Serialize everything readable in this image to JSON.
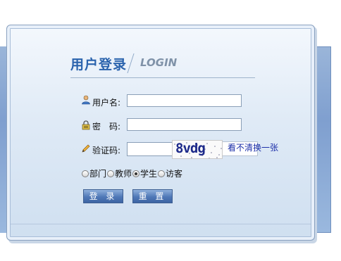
{
  "header": {
    "title_cn": "用户登录",
    "title_en": "LOGIN"
  },
  "form": {
    "username_label": "用户名:",
    "username_value": "",
    "password_label": "密　码:",
    "password_value": "",
    "captcha_label": "验证码:",
    "captcha_value": "",
    "captcha_image_text": "8vdg",
    "captcha_refresh": "看不清换一张"
  },
  "roles": [
    {
      "label": "部门",
      "checked": false
    },
    {
      "label": "教师",
      "checked": false
    },
    {
      "label": "学生",
      "checked": true
    },
    {
      "label": "访客",
      "checked": false
    }
  ],
  "buttons": {
    "login": "登 录",
    "reset": "重 置"
  },
  "icons": {
    "username": "user-icon",
    "password": "lock-icon",
    "captcha": "pencil-icon"
  }
}
